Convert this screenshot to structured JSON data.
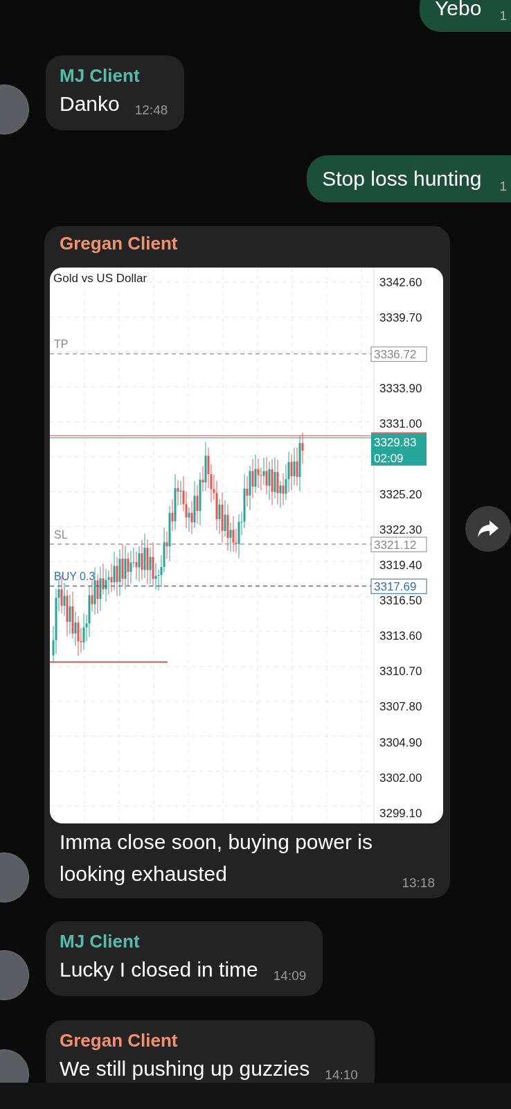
{
  "messages": [
    {
      "kind": "outgoing",
      "text": "Yebo",
      "time": "1"
    },
    {
      "kind": "incoming",
      "sender": "MJ Client",
      "color": "#53bdab",
      "text": "Danko",
      "time": "12:48"
    },
    {
      "kind": "outgoing",
      "text": "Stop loss hunting",
      "time": "1"
    },
    {
      "kind": "image",
      "sender": "Gregan Client",
      "color": "#f2916d",
      "text": "Imma close soon, buying power is looking exhausted",
      "time": "13:18",
      "chart": {
        "title": "Gold vs US Dollar",
        "price_ticks": [
          "3342.60",
          "3339.70",
          "3333.90",
          "3331.00",
          "3325.20",
          "3322.30",
          "3319.40",
          "3316.50",
          "3313.60",
          "3310.70",
          "3307.80",
          "3304.90",
          "3302.00",
          "3299.10"
        ],
        "levels": [
          {
            "kind": "tp",
            "label": "TP",
            "price_label": "3336.72"
          },
          {
            "kind": "sl",
            "label": "SL",
            "price_label": "3321.12"
          },
          {
            "kind": "buy",
            "label": "BUY 0.3",
            "price_label": "3317.69"
          }
        ],
        "current_price": "3329.83",
        "countdown": "02:09"
      }
    },
    {
      "kind": "incoming",
      "sender": "MJ Client",
      "color": "#53bdab",
      "text": "Lucky I closed in time",
      "time": "14:09"
    },
    {
      "kind": "incoming",
      "sender": "Gregan Client",
      "color": "#f2916d",
      "text": "We still pushing up guzzies",
      "time": "14:10"
    }
  ]
}
